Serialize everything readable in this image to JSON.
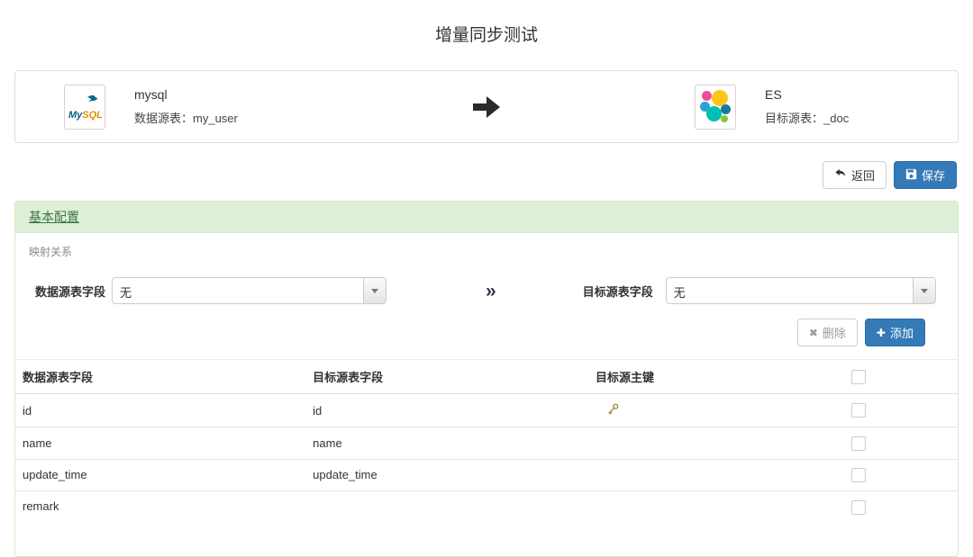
{
  "page": {
    "title": "增量同步测试"
  },
  "flow": {
    "source": {
      "name": "mysql",
      "table_label": "数据源表：",
      "table": "my_user"
    },
    "target": {
      "name": "ES",
      "table_label": "目标源表：",
      "table": "_doc"
    }
  },
  "toolbar": {
    "back_label": "返回",
    "save_label": "保存"
  },
  "panel": {
    "title": "基本配置",
    "section_label": "映射关系",
    "mapping": {
      "source_field_label": "数据源表字段",
      "source_field_value": "无",
      "chevron": "»",
      "target_field_label": "目标源表字段",
      "target_field_value": "无"
    },
    "actions": {
      "delete_glyph": "✖",
      "delete_label": "删除",
      "add_glyph": "✚",
      "add_label": "添加"
    },
    "table": {
      "headers": {
        "source": "数据源表字段",
        "target": "目标源表字段",
        "primary_key": "目标源主键"
      },
      "rows": [
        {
          "source": "id",
          "target": "id",
          "is_primary_key": true
        },
        {
          "source": "name",
          "target": "name",
          "is_primary_key": false
        },
        {
          "source": "update_time",
          "target": "update_time",
          "is_primary_key": false
        },
        {
          "source": "remark",
          "target": "",
          "is_primary_key": false
        }
      ]
    }
  },
  "colors": {
    "primary_blue": "#337ab7",
    "primary_blue_border": "#2e6da4",
    "panel_header_bg": "#dff0d8",
    "panel_border": "#d6e9c6",
    "panel_title_green": "#3c763d",
    "key_icon_gold": "#a5883e"
  }
}
